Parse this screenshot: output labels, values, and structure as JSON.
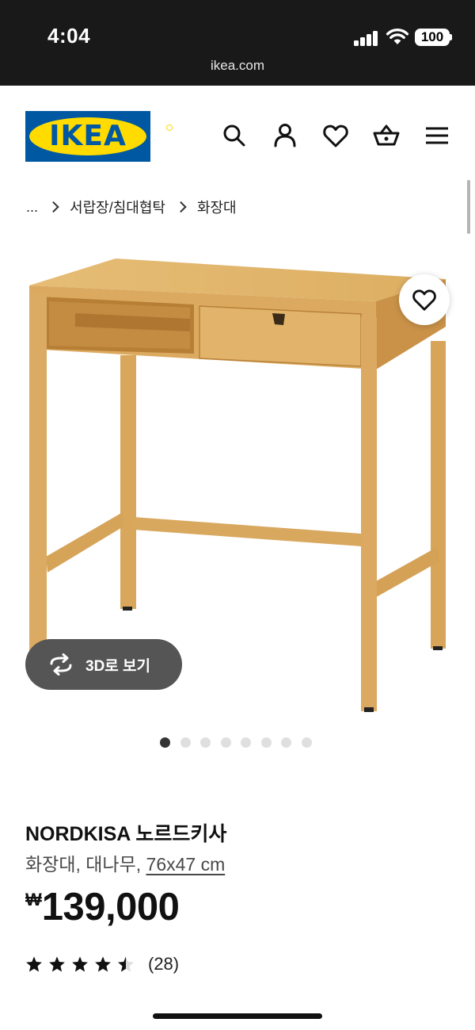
{
  "status_bar": {
    "time": "4:04",
    "battery": "100",
    "url": "ikea.com"
  },
  "header": {
    "logo_text": "IKEA",
    "icons": [
      "search-icon",
      "profile-icon",
      "heart-icon",
      "cart-icon",
      "menu-icon"
    ]
  },
  "breadcrumb": {
    "items": [
      "...",
      "서랍장/침대협탁",
      "화장대"
    ]
  },
  "gallery": {
    "view_3d_label": "3D로 보기",
    "image_count": 8,
    "active_index": 0
  },
  "product": {
    "name": "NORDKISA 노르드키사",
    "description": "화장대, 대나무, ",
    "size": "76x47 cm",
    "currency": "₩",
    "price": "139,000",
    "rating": 4.5,
    "review_count": "(28)"
  },
  "colors": {
    "ikea_blue": "#0058a3",
    "ikea_yellow": "#ffdb00",
    "bamboo": "#d6a760"
  }
}
